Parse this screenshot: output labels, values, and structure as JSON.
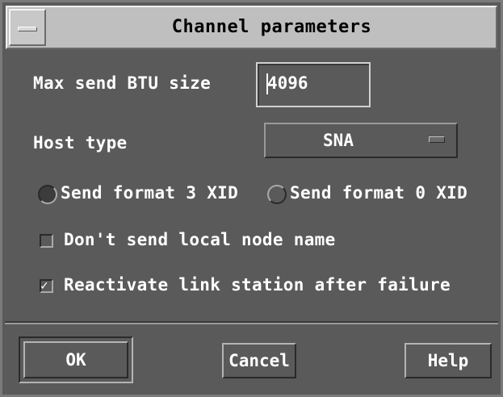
{
  "window": {
    "title": "Channel parameters",
    "background": "#5a5a5a",
    "titlebar_bg": "#bfbfbf"
  },
  "fields": {
    "max_send_btu": {
      "label": "Max send BTU size",
      "value": "4096"
    },
    "host_type": {
      "label": "Host type",
      "selected": "SNA"
    }
  },
  "xid_format": {
    "options": [
      {
        "label": "Send format 3 XID",
        "selected": true
      },
      {
        "label": "Send format 0 XID",
        "selected": false
      }
    ]
  },
  "checkboxes": {
    "dont_send_node_name": {
      "label": "Don't send local node name",
      "checked": false
    },
    "reactivate_link": {
      "label": "Reactivate link station after failure",
      "checked": true,
      "check_glyph": "✓"
    }
  },
  "buttons": {
    "ok": "OK",
    "cancel": "Cancel",
    "help": "Help"
  },
  "icons": {
    "window_menu": "window-menu-icon",
    "option_indicator": "option-menu-indicator-icon",
    "check": "checkmark-icon"
  }
}
